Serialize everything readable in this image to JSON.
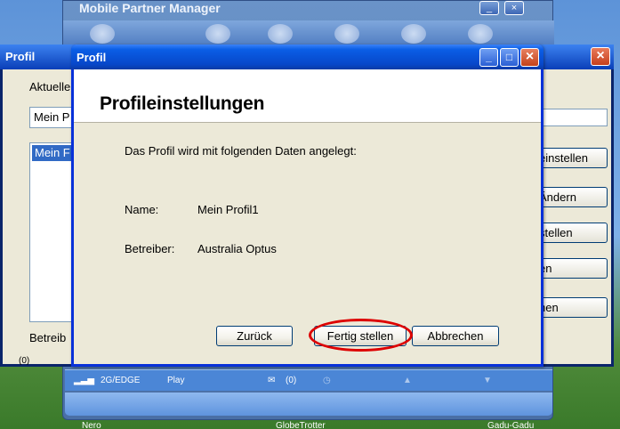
{
  "background_window": {
    "title": "Mobile Partner Manager",
    "minimize": "_",
    "close": "×",
    "status": {
      "network": "2G/EDGE",
      "play": "Play",
      "messages": "(0)"
    }
  },
  "outer_dialog": {
    "title": "Profil",
    "close": "×",
    "current_label": "Aktuelle",
    "current_value": "Mein P",
    "list_item": "Mein F",
    "operator_label": "Betreib",
    "buttons": [
      "einstellen",
      "Ändern",
      "stellen",
      "en",
      "hen"
    ],
    "count": "(0)"
  },
  "desktop": {
    "icons": [
      "Nero",
      "GlobeTrotter",
      "Gadu-Gadu"
    ]
  },
  "dialog": {
    "title": "Profil",
    "minimize": "_",
    "maximize": "□",
    "close": "×",
    "heading": "Profileinstellungen",
    "intro": "Das Profil wird mit folgenden Daten angelegt:",
    "name_label": "Name:",
    "name_value": "Mein Profil1",
    "operator_label": "Betreiber:",
    "operator_value": "Australia Optus",
    "buttons": {
      "back": "Zurück",
      "finish": "Fertig stellen",
      "cancel": "Abbrechen"
    },
    "highlight_color": "#dd0000"
  }
}
